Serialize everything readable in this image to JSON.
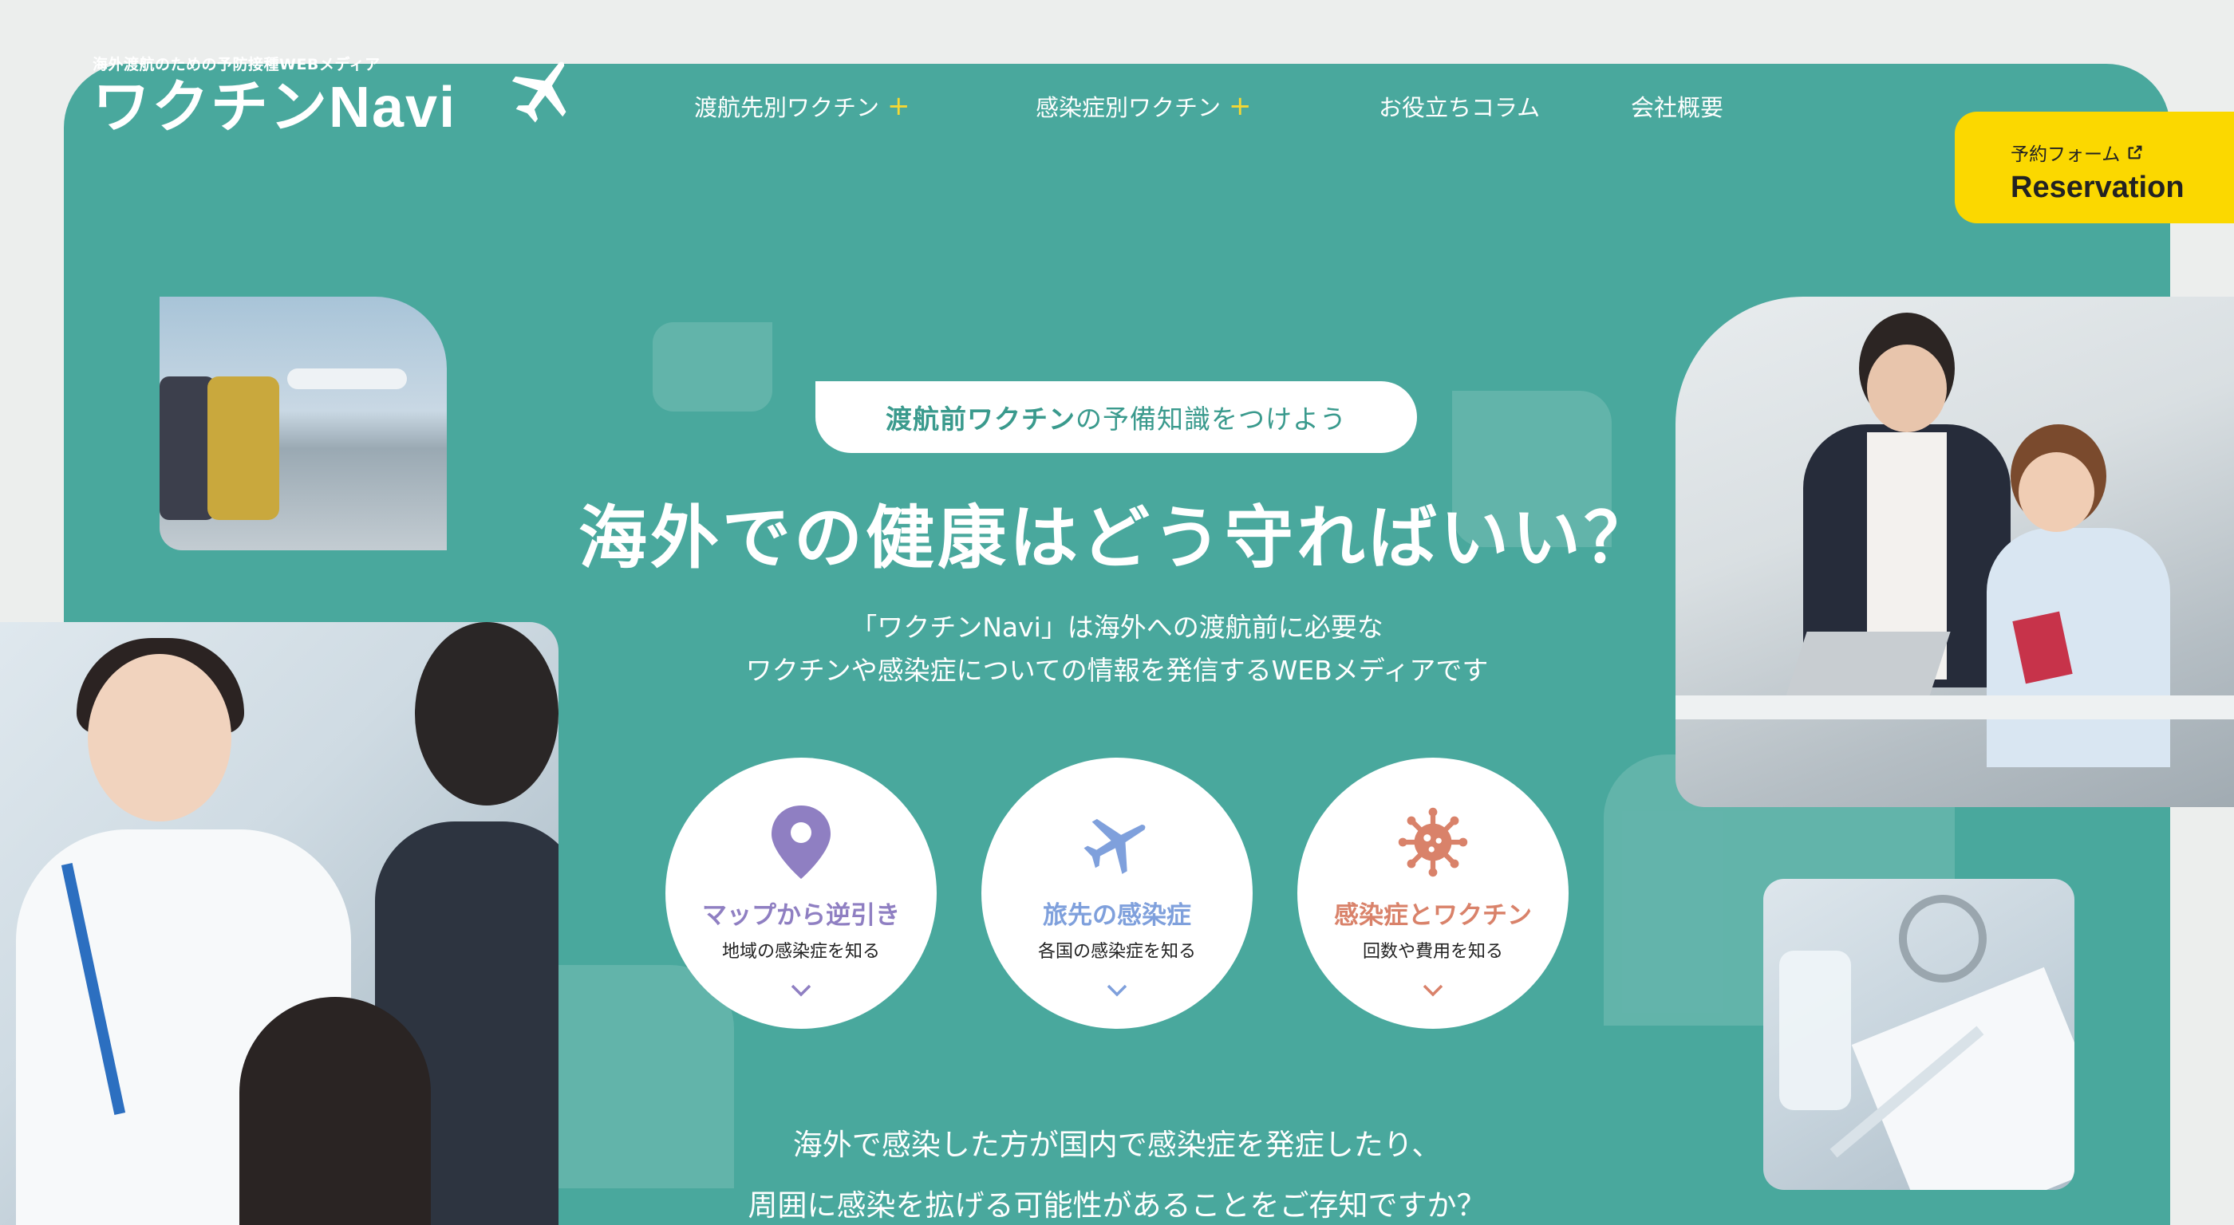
{
  "colors": {
    "hero_bg": "#49a89d",
    "accent_yellow": "#fbd800",
    "page_bg": "#eceeed",
    "map_purple": "#8f7fc2",
    "plane_blue": "#7fa0dc",
    "virus_coral": "#d9826a"
  },
  "logo": {
    "tagline": "海外渡航のための予防接種WEBメディア",
    "name": "ワクチンNavi",
    "icon": "airplane-icon"
  },
  "nav": {
    "items": [
      {
        "label": "渡航先別ワクチン",
        "plus": "+"
      },
      {
        "label": "感染症別ワクチン",
        "plus": "+"
      },
      {
        "label": "お役立ちコラム"
      },
      {
        "label": "会社概要"
      }
    ]
  },
  "reservation": {
    "label_top": "予約フォーム",
    "label_main": "Reservation",
    "icon": "external-link-icon"
  },
  "hero": {
    "pill_bold": "渡航前ワクチン",
    "pill_rest": "の予備知識をつけよう",
    "headline": "海外での健康はどう守ればいい？",
    "desc_line1": "「ワクチンNavi」は海外への渡航前に必要な",
    "desc_line2": "ワクチンや感染症についての情報を発信するWEBメディアです"
  },
  "cards": [
    {
      "title": "マップから逆引き",
      "sub": "地域の感染症を知る",
      "icon": "map-pin-icon",
      "color": "#8f7fc2"
    },
    {
      "title": "旅先の感染症",
      "sub": "各国の感染症を知る",
      "icon": "airplane-icon",
      "color": "#7fa0dc"
    },
    {
      "title": "感染症とワクチン",
      "sub": "回数や費用を知る",
      "icon": "virus-icon",
      "color": "#d9826a"
    }
  ],
  "bottom": {
    "line1": "海外で感染した方が国内で感染症を発症したり、",
    "line2": "周囲に感染を拡げる可能性があることをご存知ですか？"
  }
}
